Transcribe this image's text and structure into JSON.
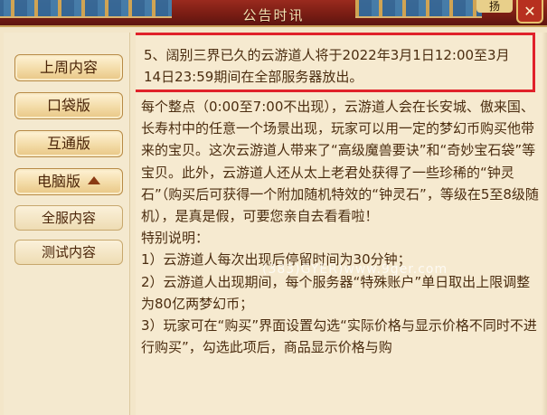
{
  "header": {
    "title": "公告时讯",
    "corner_text": "扬",
    "close_label": "✕"
  },
  "sidebar": {
    "items": [
      {
        "label": "上周内容"
      },
      {
        "label": "口袋版"
      },
      {
        "label": "互通版"
      },
      {
        "label": "电脑版"
      }
    ],
    "sub_items": [
      {
        "label": "全服内容"
      },
      {
        "label": "测试内容"
      }
    ]
  },
  "content": {
    "highlight": "5、阔别三界已久的云游道人将于2022年3月1日12:00至3月14日23:59期间在全部服务器放出。",
    "paragraphs": [
      "每个整点（0:00至7:00不出现），云游道人会在长安城、傲来国、长寿村中的任意一个场景出现，玩家可以用一定的梦幻币购买他带来的宝贝。这次云游道人带来了“高级魔兽要诀”和“奇妙宝石袋”等宝贝。此外，云游道人还从太上老君处获得了一些珍稀的“钟灵石”（购买后可获得一个附加随机特效的“钟灵石”，等级在5至8级随机），是真是假，可要您亲自去看看啦！",
      "特别说明：",
      "1）云游道人每次出现后停留时间为30分钟；",
      "2）云游道人出现期间，每个服务器“特殊账户”单日取出上限调整为80亿两梦幻币；",
      "3）玩家可在“购买”界面设置勾选“实际价格与显示价格不同时不进行购买”，勾选此项后，商品显示价格与购"
    ],
    "watermark": "(383)GYER)www.9ger.com"
  },
  "colors": {
    "header_bg": "#7a1d14",
    "highlight_border": "#e0222a",
    "text": "#4b2d10",
    "panel_bg": "#f6ead0"
  }
}
